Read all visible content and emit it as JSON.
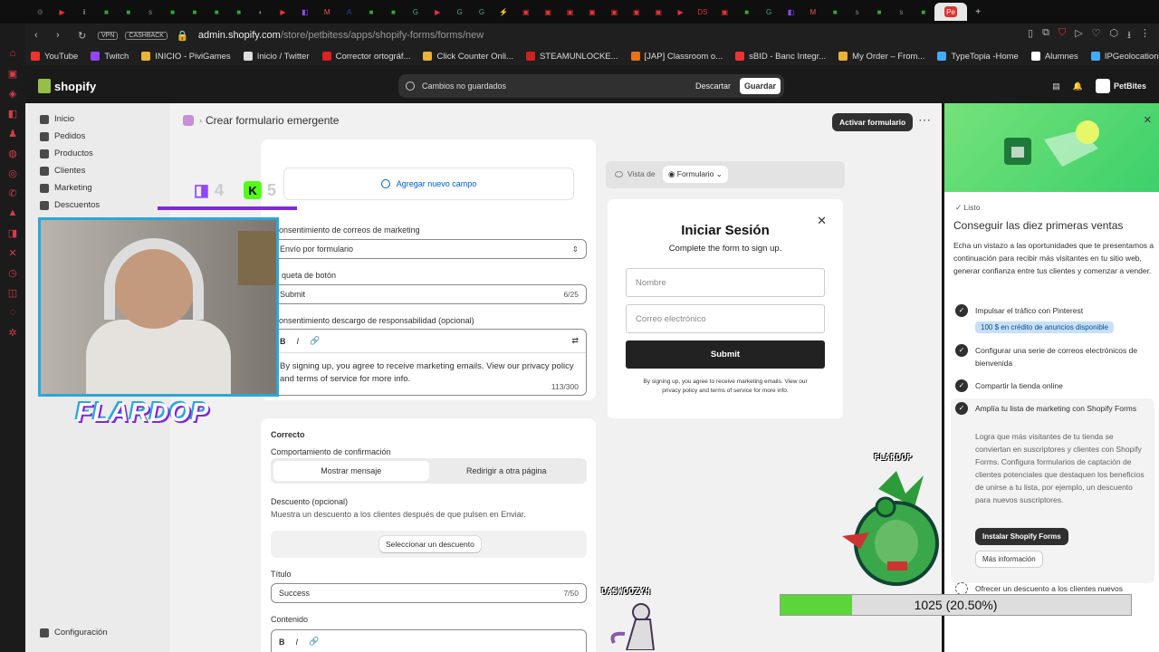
{
  "browser": {
    "url_host": "admin.shopify.com",
    "url_path": "/store/petbitess/apps/shopify-forms/forms/new",
    "badges": [
      "VPN",
      "CASHBACK"
    ],
    "active_tab": "Pe",
    "tabs": [
      {
        "g": "⚙",
        "c": "#666"
      },
      {
        "g": "▶",
        "c": "#e33"
      },
      {
        "g": "i",
        "c": "#fff"
      },
      {
        "g": "■",
        "c": "#3a3"
      },
      {
        "g": "■",
        "c": "#3a3"
      },
      {
        "g": "s",
        "c": "#888"
      },
      {
        "g": "■",
        "c": "#3a3"
      },
      {
        "g": "■",
        "c": "#3a3"
      },
      {
        "g": "■",
        "c": "#3a3"
      },
      {
        "g": "■",
        "c": "#3a3"
      },
      {
        "g": "◐",
        "c": "#888"
      },
      {
        "g": "▶",
        "c": "#e33"
      },
      {
        "g": "◧",
        "c": "#9146ff"
      },
      {
        "g": "M",
        "c": "#e55"
      },
      {
        "g": "A",
        "c": "#24a"
      },
      {
        "g": "■",
        "c": "#3a3"
      },
      {
        "g": "■",
        "c": "#3a3"
      },
      {
        "g": "G",
        "c": "#4a8"
      },
      {
        "g": "▶",
        "c": "#e33"
      },
      {
        "g": "G",
        "c": "#4a8"
      },
      {
        "g": "G",
        "c": "#4a8"
      },
      {
        "g": "⚡",
        "c": "#38f"
      },
      {
        "g": "▣",
        "c": "#e33"
      },
      {
        "g": "▣",
        "c": "#e33"
      },
      {
        "g": "▣",
        "c": "#e33"
      },
      {
        "g": "▣",
        "c": "#e33"
      },
      {
        "g": "▣",
        "c": "#e33"
      },
      {
        "g": "▣",
        "c": "#e33"
      },
      {
        "g": "▣",
        "c": "#e33"
      },
      {
        "g": "▶",
        "c": "#e33"
      },
      {
        "g": "DS",
        "c": "#d33"
      },
      {
        "g": "▣",
        "c": "#e33"
      },
      {
        "g": "■",
        "c": "#3a3"
      },
      {
        "g": "G",
        "c": "#4a8"
      },
      {
        "g": "◧",
        "c": "#9146ff"
      },
      {
        "g": "M",
        "c": "#e55"
      },
      {
        "g": "■",
        "c": "#3a3"
      },
      {
        "g": "s",
        "c": "#888"
      },
      {
        "g": "■",
        "c": "#3a3"
      },
      {
        "g": "s",
        "c": "#888"
      },
      {
        "g": "■",
        "c": "#3a3"
      }
    ]
  },
  "bookmarks": [
    {
      "label": "YouTube",
      "color": "#e33"
    },
    {
      "label": "Twitch",
      "color": "#9146ff"
    },
    {
      "label": "INICIO - PiviGames",
      "color": "#e9b23a"
    },
    {
      "label": "Inicio / Twitter",
      "color": "#ddd"
    },
    {
      "label": "Corrector ortográf...",
      "color": "#d22"
    },
    {
      "label": "Click Counter Onli...",
      "color": "#e9b23a"
    },
    {
      "label": "STEAMUNLOCKE...",
      "color": "#c22"
    },
    {
      "label": "[JAP] Classroom o...",
      "color": "#e8711a"
    },
    {
      "label": "sBID - Banc Integr...",
      "color": "#e33"
    },
    {
      "label": "My Order – From...",
      "color": "#e9b23a"
    },
    {
      "label": "TypeTopia -Home",
      "color": "#4af"
    },
    {
      "label": "Alumnes",
      "color": "#fff"
    },
    {
      "label": "IPGeolocation API...",
      "color": "#4af"
    }
  ],
  "shopify": {
    "logo": "shopify",
    "unsaved": "Cambios no guardados",
    "discard": "Descartar",
    "save": "Guardar",
    "store": "PetBites"
  },
  "sidebar": {
    "items": [
      "Inicio",
      "Pedidos",
      "Productos",
      "Clientes",
      "Marketing",
      "Descuentos"
    ],
    "settings": "Configuración"
  },
  "page": {
    "title": "Crear formulario emergente",
    "activate": "Activar formulario",
    "add_field": "Agregar nuevo campo",
    "consent_label": "onsentimiento de correos de marketing",
    "consent_value": "Envío por formulario",
    "button_label": "queta de botón",
    "button_value": "Submit",
    "button_count": "6/25",
    "disclaimer_label": "onsentimiento descargo de responsabilidad (opcional)",
    "disclaimer_text": "By signing up, you agree to receive marketing emails. View our privacy policy and terms of service for more info.",
    "disclaimer_count": "113/300",
    "success_title": "Correcto",
    "confirm_label": "Comportamiento de confirmación",
    "seg_show": "Mostrar mensaje",
    "seg_redirect": "Redirigir a otra página",
    "discount_label": "Descuento (opcional)",
    "discount_help": "Muestra un descuento a los clientes después de que pulsen en Enviar.",
    "discount_button": "Seleccionar un descuento",
    "title_label": "Título",
    "title_value": "Success",
    "title_count": "7/50",
    "content_label": "Contenido"
  },
  "preview": {
    "view_label": "Vista de",
    "view_select": "Formulario",
    "heading": "Iniciar Sesión",
    "sub": "Complete the form to sign up.",
    "name_ph": "Nombre",
    "email_ph": "Correo electrónico",
    "submit": "Submit",
    "fine": "By signing up, you agree to receive marketing emails. View our privacy policy and terms of service for more info."
  },
  "panel": {
    "status": "Listo",
    "title": "Conseguir las diez primeras ventas",
    "desc": "Echa un vistazo a las oportunidades que te presentamos a continuación para recibir más visitantes en tu sitio web, generar confianza entre tus clientes y comenzar a vender.",
    "steps": [
      "Impulsar el tráfico con Pinterest",
      "Configurar una serie de correos electrónicos de bienvenida",
      "Compartir la tienda online",
      "Amplía tu lista de marketing con Shopify Forms",
      "Ofrecer un descuento a los clientes nuevos"
    ],
    "pill": "100 $ en crédito de anuncios disponible",
    "step4_desc": "Logra que más visitantes de tu tienda se conviertan en suscriptores y clientes con Shopify Forms. Configura formularios de captación de clientes potenciales que destaquen los beneficios de unirse a tu lista, por ejemplo, un descuento para nuevos suscriptores.",
    "install": "Instalar Shopify Forms",
    "more": "Más información"
  },
  "overlay": {
    "streamer": "FLARDOP",
    "twitch_count": "4",
    "kick_count": "5",
    "sprite1": "FLARDOP",
    "sprite2": "DASWOOZYH",
    "progress_text": "1025 (20.50%)",
    "progress": 0.205
  },
  "colors": {
    "accent": "#303030",
    "link": "#005bd3",
    "kick": "#53fc18",
    "twitch": "#9146ff"
  }
}
